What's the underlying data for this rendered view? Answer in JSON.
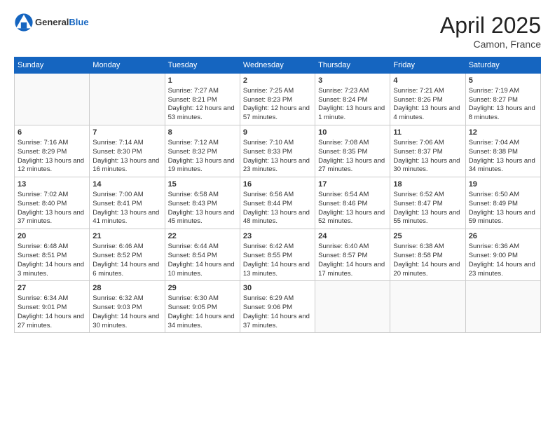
{
  "header": {
    "logo_general": "General",
    "logo_blue": "Blue",
    "month": "April 2025",
    "location": "Camon, France"
  },
  "weekdays": [
    "Sunday",
    "Monday",
    "Tuesday",
    "Wednesday",
    "Thursday",
    "Friday",
    "Saturday"
  ],
  "weeks": [
    [
      {
        "day": "",
        "info": ""
      },
      {
        "day": "",
        "info": ""
      },
      {
        "day": "1",
        "info": "Sunrise: 7:27 AM\nSunset: 8:21 PM\nDaylight: 12 hours and 53 minutes."
      },
      {
        "day": "2",
        "info": "Sunrise: 7:25 AM\nSunset: 8:23 PM\nDaylight: 12 hours and 57 minutes."
      },
      {
        "day": "3",
        "info": "Sunrise: 7:23 AM\nSunset: 8:24 PM\nDaylight: 13 hours and 1 minute."
      },
      {
        "day": "4",
        "info": "Sunrise: 7:21 AM\nSunset: 8:26 PM\nDaylight: 13 hours and 4 minutes."
      },
      {
        "day": "5",
        "info": "Sunrise: 7:19 AM\nSunset: 8:27 PM\nDaylight: 13 hours and 8 minutes."
      }
    ],
    [
      {
        "day": "6",
        "info": "Sunrise: 7:16 AM\nSunset: 8:29 PM\nDaylight: 13 hours and 12 minutes."
      },
      {
        "day": "7",
        "info": "Sunrise: 7:14 AM\nSunset: 8:30 PM\nDaylight: 13 hours and 16 minutes."
      },
      {
        "day": "8",
        "info": "Sunrise: 7:12 AM\nSunset: 8:32 PM\nDaylight: 13 hours and 19 minutes."
      },
      {
        "day": "9",
        "info": "Sunrise: 7:10 AM\nSunset: 8:33 PM\nDaylight: 13 hours and 23 minutes."
      },
      {
        "day": "10",
        "info": "Sunrise: 7:08 AM\nSunset: 8:35 PM\nDaylight: 13 hours and 27 minutes."
      },
      {
        "day": "11",
        "info": "Sunrise: 7:06 AM\nSunset: 8:37 PM\nDaylight: 13 hours and 30 minutes."
      },
      {
        "day": "12",
        "info": "Sunrise: 7:04 AM\nSunset: 8:38 PM\nDaylight: 13 hours and 34 minutes."
      }
    ],
    [
      {
        "day": "13",
        "info": "Sunrise: 7:02 AM\nSunset: 8:40 PM\nDaylight: 13 hours and 37 minutes."
      },
      {
        "day": "14",
        "info": "Sunrise: 7:00 AM\nSunset: 8:41 PM\nDaylight: 13 hours and 41 minutes."
      },
      {
        "day": "15",
        "info": "Sunrise: 6:58 AM\nSunset: 8:43 PM\nDaylight: 13 hours and 45 minutes."
      },
      {
        "day": "16",
        "info": "Sunrise: 6:56 AM\nSunset: 8:44 PM\nDaylight: 13 hours and 48 minutes."
      },
      {
        "day": "17",
        "info": "Sunrise: 6:54 AM\nSunset: 8:46 PM\nDaylight: 13 hours and 52 minutes."
      },
      {
        "day": "18",
        "info": "Sunrise: 6:52 AM\nSunset: 8:47 PM\nDaylight: 13 hours and 55 minutes."
      },
      {
        "day": "19",
        "info": "Sunrise: 6:50 AM\nSunset: 8:49 PM\nDaylight: 13 hours and 59 minutes."
      }
    ],
    [
      {
        "day": "20",
        "info": "Sunrise: 6:48 AM\nSunset: 8:51 PM\nDaylight: 14 hours and 3 minutes."
      },
      {
        "day": "21",
        "info": "Sunrise: 6:46 AM\nSunset: 8:52 PM\nDaylight: 14 hours and 6 minutes."
      },
      {
        "day": "22",
        "info": "Sunrise: 6:44 AM\nSunset: 8:54 PM\nDaylight: 14 hours and 10 minutes."
      },
      {
        "day": "23",
        "info": "Sunrise: 6:42 AM\nSunset: 8:55 PM\nDaylight: 14 hours and 13 minutes."
      },
      {
        "day": "24",
        "info": "Sunrise: 6:40 AM\nSunset: 8:57 PM\nDaylight: 14 hours and 17 minutes."
      },
      {
        "day": "25",
        "info": "Sunrise: 6:38 AM\nSunset: 8:58 PM\nDaylight: 14 hours and 20 minutes."
      },
      {
        "day": "26",
        "info": "Sunrise: 6:36 AM\nSunset: 9:00 PM\nDaylight: 14 hours and 23 minutes."
      }
    ],
    [
      {
        "day": "27",
        "info": "Sunrise: 6:34 AM\nSunset: 9:01 PM\nDaylight: 14 hours and 27 minutes."
      },
      {
        "day": "28",
        "info": "Sunrise: 6:32 AM\nSunset: 9:03 PM\nDaylight: 14 hours and 30 minutes."
      },
      {
        "day": "29",
        "info": "Sunrise: 6:30 AM\nSunset: 9:05 PM\nDaylight: 14 hours and 34 minutes."
      },
      {
        "day": "30",
        "info": "Sunrise: 6:29 AM\nSunset: 9:06 PM\nDaylight: 14 hours and 37 minutes."
      },
      {
        "day": "",
        "info": ""
      },
      {
        "day": "",
        "info": ""
      },
      {
        "day": "",
        "info": ""
      }
    ]
  ]
}
